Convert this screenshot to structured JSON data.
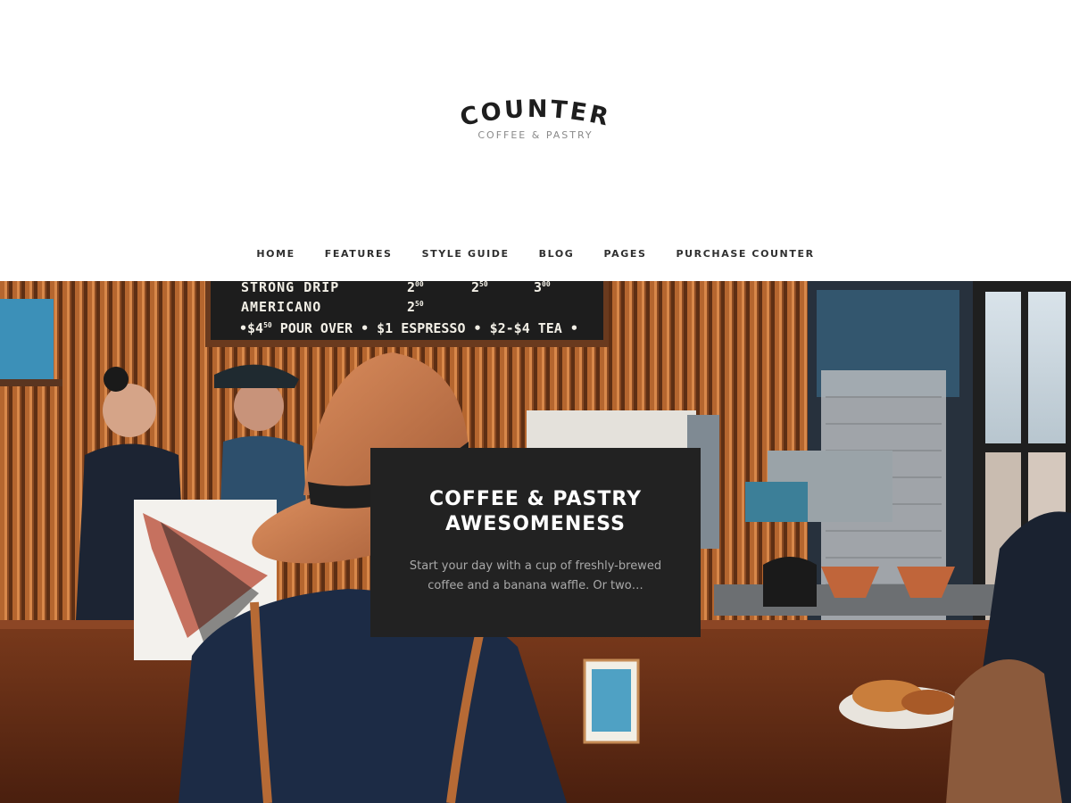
{
  "site": {
    "name": "COUNTER",
    "tagline": "COFFEE & PASTRY"
  },
  "nav": {
    "items": [
      {
        "label": "HOME"
      },
      {
        "label": "FEATURES"
      },
      {
        "label": "STYLE GUIDE"
      },
      {
        "label": "BLOG"
      },
      {
        "label": "PAGES"
      },
      {
        "label": "PURCHASE COUNTER"
      }
    ]
  },
  "hero": {
    "title_line1": "COFFEE & PASTRY",
    "title_line2": "AWESOMENESS",
    "text": "Start your day with a cup of freshly-brewed coffee and a banana waffle.  Or two…"
  },
  "menu_board": {
    "row1": {
      "item": "STRONG DRIP",
      "price1": "2",
      "sup1": "00",
      "price2": "2",
      "sup2": "50",
      "price3": "3",
      "sup3": "00"
    },
    "row2": {
      "item": "AMERICANO",
      "price1": "2",
      "sup1": "50"
    },
    "row3": "•$4",
    "row3_sup": "50",
    "row3_rest": " POUR OVER • $1 ESPRESSO • $2-$4 TEA •"
  },
  "colors": {
    "header_bg": "#ffffff",
    "logo_text": "#1e1e1e",
    "tagline": "#8a8a8a",
    "nav_text": "#2f2f2f",
    "hero_box_bg": "#222222",
    "hero_title": "#ffffff",
    "hero_text": "#a9a9a9"
  },
  "icons": {
    "logo": "counter-arched-wordmark"
  }
}
